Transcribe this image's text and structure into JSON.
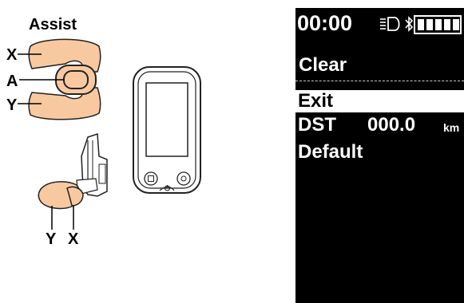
{
  "left_panel": {
    "assist_label": "Assist",
    "switch_x_label": "X",
    "switch_a_label": "A",
    "switch_y_label": "Y",
    "lower_y_label": "Y",
    "lower_x_label": "X"
  },
  "display": {
    "clock": "00:00",
    "icons": [
      "light-icon",
      "bluetooth-icon",
      "battery-icon"
    ],
    "battery_level": "5 of 5",
    "header": "Clear",
    "menu": {
      "exit_label": "Exit",
      "dst_label": "DST",
      "dst_value": "000.0",
      "dst_unit": "km",
      "default_label": "Default"
    },
    "selected_item": "Exit"
  }
}
